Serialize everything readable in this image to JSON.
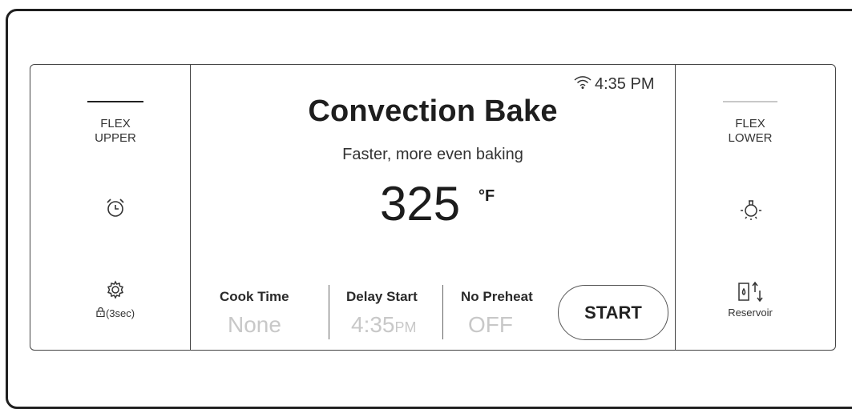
{
  "status": {
    "time": "4:35 PM",
    "wifi_icon": "wifi-icon"
  },
  "left": {
    "flex_upper": {
      "line1": "FLEX",
      "line2": "UPPER"
    },
    "timer_icon": "alarm-clock-icon",
    "settings": {
      "icon": "gear-icon",
      "lock_label": "(3sec)",
      "lock_icon": "lock-icon"
    }
  },
  "right": {
    "flex_lower": {
      "line1": "FLEX",
      "line2": "LOWER"
    },
    "light_icon": "oven-light-icon",
    "reservoir": {
      "icon": "reservoir-icon",
      "label": "Reservoir"
    }
  },
  "main": {
    "mode": "Convection Bake",
    "description": "Faster, more even baking",
    "temperature": "325",
    "temperature_unit": "°F"
  },
  "options": {
    "cook_time": {
      "label": "Cook Time",
      "value": "None"
    },
    "delay_start": {
      "label": "Delay Start",
      "value": "4:35",
      "value_suffix": "PM"
    },
    "no_preheat": {
      "label": "No Preheat",
      "value": "OFF"
    }
  },
  "start_button": {
    "label": "START"
  },
  "colors": {
    "text": "#222222",
    "inactive": "#c8c8c8",
    "border": "#444444",
    "flex_upper_bar": "#222222",
    "flex_lower_bar": "#c8c8c8"
  }
}
